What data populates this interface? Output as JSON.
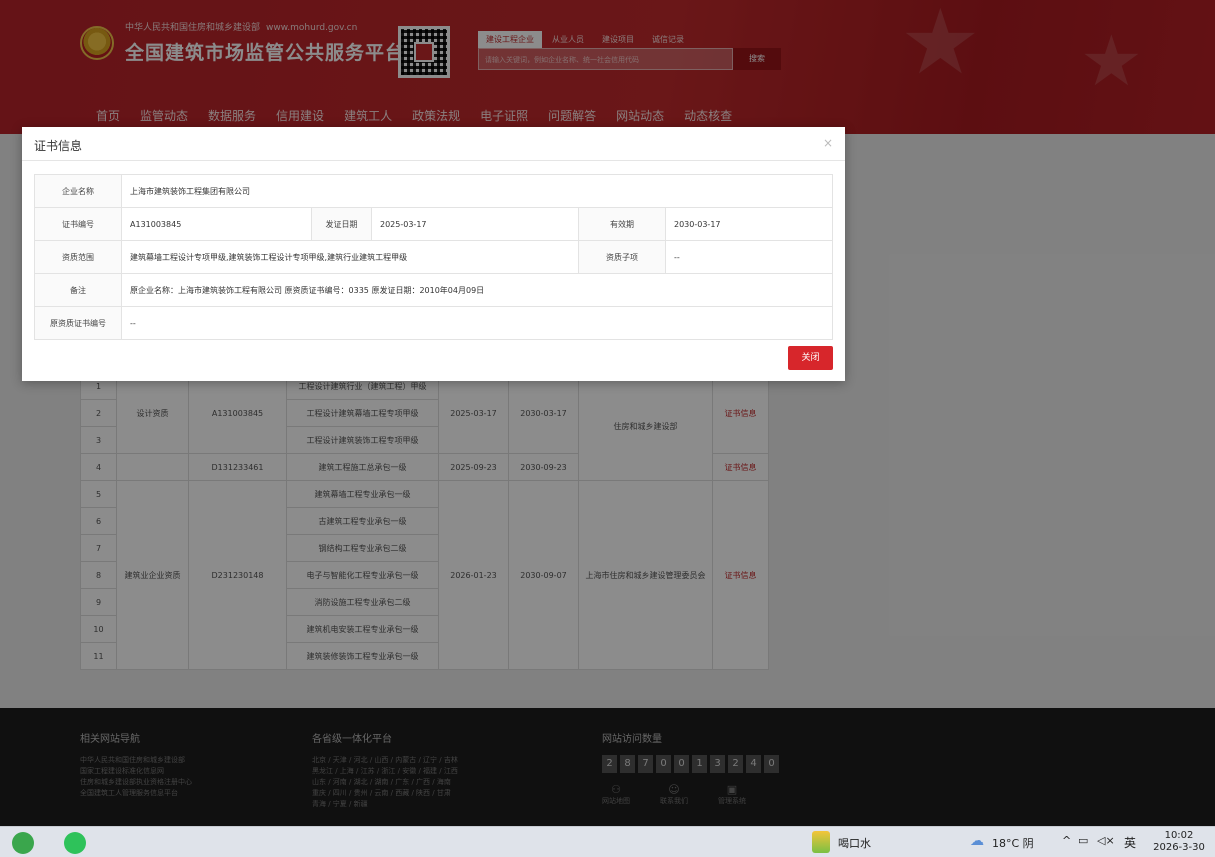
{
  "header": {
    "org_name": "中华人民共和国住房和城乡建设部",
    "org_url": "www.mohurd.gov.cn",
    "site_title": "全国建筑市场监管公共服务平台",
    "search_tabs": [
      "建设工程企业",
      "从业人员",
      "建设项目",
      "诚信记录"
    ],
    "search_placeholder": "请输入关键词，例如企业名称、统一社会信用代码",
    "search_button": "搜索"
  },
  "nav": [
    "首页",
    "监管动态",
    "数据服务",
    "信用建设",
    "建筑工人",
    "政策法规",
    "电子证照",
    "问题解答",
    "网站动态",
    "动态核查"
  ],
  "background_table": {
    "rows": [
      {
        "no": "1",
        "scope": "工程设计建筑行业（建筑工程）甲级"
      },
      {
        "no": "2",
        "scope": "工程设计建筑幕墙工程专项甲级"
      },
      {
        "no": "3",
        "scope": "工程设计建筑装饰工程专项甲级"
      },
      {
        "no": "4",
        "scope": "建筑工程施工总承包一级"
      },
      {
        "no": "5",
        "scope": "建筑幕墙工程专业承包一级"
      },
      {
        "no": "6",
        "scope": "古建筑工程专业承包一级"
      },
      {
        "no": "7",
        "scope": "钢结构工程专业承包二级"
      },
      {
        "no": "8",
        "scope": "电子与智能化工程专业承包一级"
      },
      {
        "no": "9",
        "scope": "消防设施工程专业承包二级"
      },
      {
        "no": "10",
        "scope": "建筑机电安装工程专业承包一级"
      },
      {
        "no": "11",
        "scope": "建筑装修装饰工程专业承包一级"
      }
    ],
    "group1_type": "设计资质",
    "group1_cert": "A131003845",
    "group1_issue": "2025-03-17",
    "group1_expire": "2030-03-17",
    "group12_authority": "住房和城乡建设部",
    "group2_cert": "D131233461",
    "group2_issue": "2025-09-23",
    "group2_expire": "2030-09-23",
    "group3_type": "建筑业企业资质",
    "group3_cert": "D231230148",
    "group3_issue": "2026-01-23",
    "group3_expire": "2030-09-07",
    "group3_authority": "上海市住房和城乡建设管理委员会",
    "link_text": "证书信息"
  },
  "footer": {
    "links_head": "相关网站导航",
    "links": [
      "中华人民共和国住房和城乡建设部",
      "国家工程建设标准化信息网",
      "住房和城乡建设部执业资格注册中心",
      "全国建筑工人管理服务信息平台"
    ],
    "platform_head": "各省级一体化平台",
    "platform_lines": [
      "北京 / 天津 / 河北 / 山西 / 内蒙古 / 辽宁 / 吉林",
      "黑龙江 / 上海 / 江苏 / 浙江 / 安徽 / 福建 / 江西",
      "山东 / 河南 / 湖北 / 湖南 / 广东 / 广西 / 海南",
      "重庆 / 四川 / 贵州 / 云南 / 西藏 / 陕西 / 甘肃",
      "青海 / 宁夏 / 新疆"
    ],
    "visits_head": "网站访问数量",
    "visit_digits": [
      "2",
      "8",
      "7",
      "0",
      "0",
      "1",
      "3",
      "2",
      "4",
      "0"
    ],
    "icons": [
      {
        "label": "网站地图",
        "glyph": "⚇"
      },
      {
        "label": "联系我们",
        "glyph": "☺"
      },
      {
        "label": "管理系统",
        "glyph": "▣"
      }
    ]
  },
  "taskbar": {
    "app_item": "喝口水",
    "weather": "18°C 阴",
    "ime": "英",
    "time": "10:02",
    "date": "2026-3-30"
  },
  "modal": {
    "title": "证书信息",
    "close_x": "×",
    "labels": {
      "company": "企业名称",
      "cert_no": "证书编号",
      "issue_date": "发证日期",
      "valid_until": "有效期",
      "scope": "资质范围",
      "sub_item": "资质子项",
      "remark": "备注",
      "orig_cert": "原资质证书编号"
    },
    "values": {
      "company": "上海市建筑装饰工程集团有限公司",
      "cert_no": "A131003845",
      "issue_date": "2025-03-17",
      "valid_until": "2030-03-17",
      "scope": "建筑幕墙工程设计专项甲级,建筑装饰工程设计专项甲级,建筑行业建筑工程甲级",
      "sub_item": "--",
      "remark": "原企业名称：上海市建筑装饰工程有限公司 原资质证书编号：0335 原发证日期：2010年04月09日",
      "orig_cert": "--"
    },
    "close_button": "关闭"
  },
  "colors": {
    "brand_red": "#c12a2c",
    "button_red": "#d7262b"
  }
}
